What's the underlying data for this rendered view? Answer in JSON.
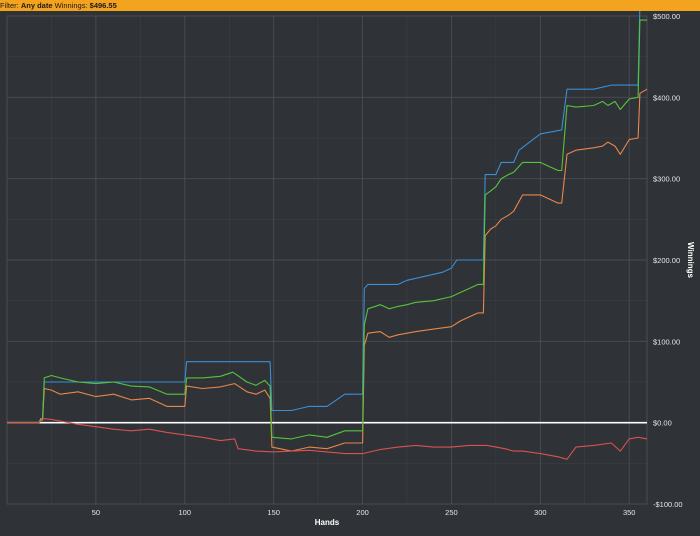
{
  "filter": {
    "prefix": "Filter:",
    "date_value": "Any date",
    "winnings_label": "Winnings:",
    "winnings_value": "$496.55"
  },
  "colors": {
    "background": "#2f3236",
    "filter_bar": "#f4a31f",
    "grid": "#4a4e53",
    "zero_line": "#ffffff"
  },
  "chart_data": {
    "type": "line",
    "xlabel": "Hands",
    "ylabel": "Winnings",
    "xlim": [
      0,
      360
    ],
    "ylim": [
      -100,
      500
    ],
    "x_ticks": [
      {
        "value": 50,
        "label": "50"
      },
      {
        "value": 100,
        "label": "100"
      },
      {
        "value": 150,
        "label": "150"
      },
      {
        "value": 200,
        "label": "200"
      },
      {
        "value": 250,
        "label": "250"
      },
      {
        "value": 300,
        "label": "300"
      },
      {
        "value": 350,
        "label": "350"
      }
    ],
    "y_ticks": [
      {
        "value": 500,
        "label": "$500.00"
      },
      {
        "value": 400,
        "label": "$400.00"
      },
      {
        "value": 300,
        "label": "$300.00"
      },
      {
        "value": 200,
        "label": "$200.00"
      },
      {
        "value": 100,
        "label": "$100.00"
      },
      {
        "value": 0,
        "label": "$0.00"
      },
      {
        "value": -100,
        "label": "-$100.00"
      }
    ],
    "grid": true,
    "zero_line": true,
    "series": [
      {
        "color": "#3a8fd8",
        "points": [
          [
            0,
            0
          ],
          [
            15,
            0
          ],
          [
            18,
            0
          ],
          [
            19,
            5
          ],
          [
            20,
            5
          ],
          [
            21,
            50
          ],
          [
            40,
            50
          ],
          [
            60,
            50
          ],
          [
            80,
            50
          ],
          [
            100,
            50
          ],
          [
            101,
            75
          ],
          [
            130,
            75
          ],
          [
            148,
            75
          ],
          [
            149,
            15
          ],
          [
            160,
            15
          ],
          [
            170,
            20
          ],
          [
            180,
            20
          ],
          [
            190,
            35
          ],
          [
            200,
            35
          ],
          [
            201,
            165
          ],
          [
            203,
            170
          ],
          [
            220,
            170
          ],
          [
            225,
            175
          ],
          [
            235,
            180
          ],
          [
            245,
            185
          ],
          [
            250,
            190
          ],
          [
            253,
            200
          ],
          [
            268,
            200
          ],
          [
            269,
            305
          ],
          [
            275,
            305
          ],
          [
            278,
            320
          ],
          [
            285,
            320
          ],
          [
            288,
            335
          ],
          [
            300,
            355
          ],
          [
            312,
            360
          ],
          [
            315,
            410
          ],
          [
            330,
            410
          ],
          [
            340,
            415
          ],
          [
            355,
            415
          ],
          [
            356,
            515
          ],
          [
            360,
            515
          ]
        ]
      },
      {
        "color": "#e8874a",
        "points": [
          [
            0,
            0
          ],
          [
            15,
            0
          ],
          [
            18,
            0
          ],
          [
            19,
            3
          ],
          [
            20,
            3
          ],
          [
            21,
            42
          ],
          [
            25,
            40
          ],
          [
            30,
            35
          ],
          [
            40,
            38
          ],
          [
            50,
            32
          ],
          [
            60,
            35
          ],
          [
            70,
            28
          ],
          [
            80,
            30
          ],
          [
            90,
            20
          ],
          [
            100,
            20
          ],
          [
            101,
            45
          ],
          [
            110,
            42
          ],
          [
            120,
            44
          ],
          [
            128,
            48
          ],
          [
            135,
            38
          ],
          [
            140,
            35
          ],
          [
            145,
            40
          ],
          [
            148,
            30
          ],
          [
            149,
            -30
          ],
          [
            160,
            -35
          ],
          [
            170,
            -30
          ],
          [
            180,
            -32
          ],
          [
            190,
            -25
          ],
          [
            200,
            -25
          ],
          [
            201,
            95
          ],
          [
            203,
            110
          ],
          [
            210,
            112
          ],
          [
            215,
            105
          ],
          [
            220,
            108
          ],
          [
            225,
            110
          ],
          [
            230,
            112
          ],
          [
            240,
            115
          ],
          [
            250,
            118
          ],
          [
            255,
            125
          ],
          [
            260,
            130
          ],
          [
            265,
            135
          ],
          [
            268,
            135
          ],
          [
            269,
            230
          ],
          [
            272,
            238
          ],
          [
            275,
            242
          ],
          [
            278,
            250
          ],
          [
            282,
            255
          ],
          [
            285,
            260
          ],
          [
            290,
            280
          ],
          [
            300,
            280
          ],
          [
            305,
            275
          ],
          [
            310,
            270
          ],
          [
            312,
            270
          ],
          [
            315,
            330
          ],
          [
            320,
            335
          ],
          [
            330,
            338
          ],
          [
            335,
            340
          ],
          [
            338,
            345
          ],
          [
            342,
            340
          ],
          [
            345,
            330
          ],
          [
            350,
            348
          ],
          [
            355,
            350
          ],
          [
            356,
            405
          ],
          [
            360,
            410
          ]
        ]
      },
      {
        "color": "#55c43a",
        "points": [
          [
            0,
            0
          ],
          [
            15,
            0
          ],
          [
            18,
            0
          ],
          [
            19,
            5
          ],
          [
            20,
            5
          ],
          [
            21,
            55
          ],
          [
            25,
            58
          ],
          [
            30,
            55
          ],
          [
            40,
            50
          ],
          [
            50,
            48
          ],
          [
            60,
            50
          ],
          [
            70,
            45
          ],
          [
            80,
            44
          ],
          [
            90,
            35
          ],
          [
            100,
            35
          ],
          [
            101,
            55
          ],
          [
            110,
            55
          ],
          [
            120,
            57
          ],
          [
            127,
            62
          ],
          [
            135,
            50
          ],
          [
            140,
            46
          ],
          [
            145,
            52
          ],
          [
            148,
            45
          ],
          [
            149,
            -18
          ],
          [
            160,
            -20
          ],
          [
            170,
            -15
          ],
          [
            180,
            -18
          ],
          [
            190,
            -10
          ],
          [
            200,
            -10
          ],
          [
            201,
            120
          ],
          [
            203,
            140
          ],
          [
            210,
            145
          ],
          [
            215,
            140
          ],
          [
            220,
            143
          ],
          [
            225,
            145
          ],
          [
            230,
            148
          ],
          [
            240,
            150
          ],
          [
            250,
            155
          ],
          [
            255,
            160
          ],
          [
            260,
            165
          ],
          [
            265,
            170
          ],
          [
            268,
            170
          ],
          [
            269,
            280
          ],
          [
            272,
            285
          ],
          [
            275,
            290
          ],
          [
            278,
            300
          ],
          [
            282,
            305
          ],
          [
            285,
            308
          ],
          [
            290,
            320
          ],
          [
            300,
            320
          ],
          [
            305,
            315
          ],
          [
            310,
            310
          ],
          [
            312,
            310
          ],
          [
            315,
            390
          ],
          [
            320,
            388
          ],
          [
            330,
            390
          ],
          [
            335,
            395
          ],
          [
            338,
            390
          ],
          [
            342,
            395
          ],
          [
            345,
            385
          ],
          [
            350,
            398
          ],
          [
            355,
            400
          ],
          [
            356,
            495
          ],
          [
            360,
            495
          ]
        ]
      },
      {
        "color": "#d9534f",
        "points": [
          [
            0,
            0
          ],
          [
            15,
            0
          ],
          [
            18,
            0
          ],
          [
            20,
            5
          ],
          [
            25,
            4
          ],
          [
            30,
            2
          ],
          [
            40,
            -2
          ],
          [
            50,
            -5
          ],
          [
            60,
            -8
          ],
          [
            70,
            -10
          ],
          [
            80,
            -8
          ],
          [
            90,
            -12
          ],
          [
            100,
            -15
          ],
          [
            110,
            -18
          ],
          [
            115,
            -20
          ],
          [
            120,
            -22
          ],
          [
            128,
            -20
          ],
          [
            130,
            -32
          ],
          [
            140,
            -35
          ],
          [
            150,
            -36
          ],
          [
            160,
            -35
          ],
          [
            170,
            -34
          ],
          [
            180,
            -36
          ],
          [
            190,
            -38
          ],
          [
            200,
            -38
          ],
          [
            210,
            -33
          ],
          [
            220,
            -30
          ],
          [
            230,
            -28
          ],
          [
            240,
            -30
          ],
          [
            250,
            -30
          ],
          [
            260,
            -28
          ],
          [
            270,
            -28
          ],
          [
            280,
            -32
          ],
          [
            285,
            -35
          ],
          [
            290,
            -35
          ],
          [
            300,
            -38
          ],
          [
            305,
            -40
          ],
          [
            310,
            -42
          ],
          [
            315,
            -45
          ],
          [
            320,
            -30
          ],
          [
            330,
            -28
          ],
          [
            340,
            -25
          ],
          [
            345,
            -35
          ],
          [
            350,
            -20
          ],
          [
            355,
            -18
          ],
          [
            360,
            -20
          ]
        ]
      }
    ]
  }
}
